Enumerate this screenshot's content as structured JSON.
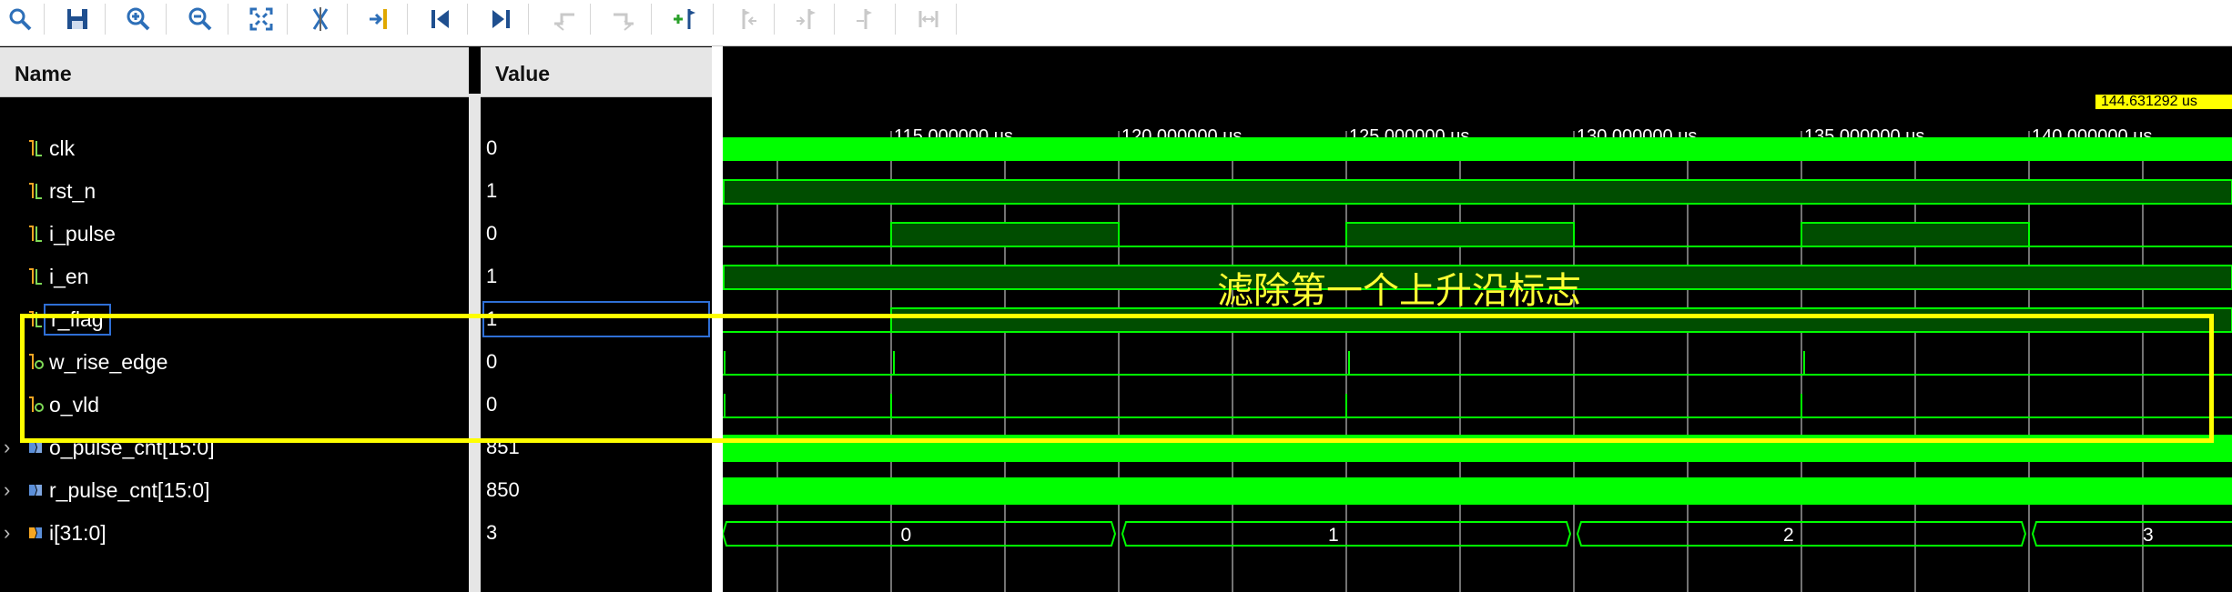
{
  "toolbar": {
    "buttons": [
      {
        "name": "search-icon",
        "enabled": true
      },
      {
        "name": "save-icon",
        "enabled": true
      },
      {
        "name": "zoom-in-icon",
        "enabled": true
      },
      {
        "name": "zoom-out-icon",
        "enabled": true
      },
      {
        "name": "zoom-fit-icon",
        "enabled": true
      },
      {
        "name": "swap-cursor-icon",
        "enabled": true
      },
      {
        "name": "go-to-cursor-icon",
        "enabled": true
      },
      {
        "name": "go-to-time-zero-icon",
        "enabled": true
      },
      {
        "name": "go-to-last-time-icon",
        "enabled": true
      },
      {
        "name": "previous-transition-icon",
        "enabled": false
      },
      {
        "name": "next-transition-icon",
        "enabled": false
      },
      {
        "name": "add-marker-icon",
        "enabled": true
      },
      {
        "name": "previous-marker-icon",
        "enabled": false
      },
      {
        "name": "next-marker-icon",
        "enabled": false
      },
      {
        "name": "swap-markers-icon",
        "enabled": false
      },
      {
        "name": "zoom-to-markers-icon",
        "enabled": false
      }
    ]
  },
  "columns": {
    "name": "Name",
    "value": "Value"
  },
  "cursor_time": "144.631292 us",
  "timeline": {
    "labels": [
      "115.000000 us",
      "120.000000 us",
      "125.000000 us",
      "130.000000 us",
      "135.000000 us",
      "140.000000 us"
    ]
  },
  "signals": [
    {
      "name": "clk",
      "value": "0",
      "type": "bit",
      "expandable": false
    },
    {
      "name": "rst_n",
      "value": "1",
      "type": "bit",
      "expandable": false
    },
    {
      "name": "i_pulse",
      "value": "0",
      "type": "bit",
      "expandable": false
    },
    {
      "name": "i_en",
      "value": "1",
      "type": "bit",
      "expandable": false
    },
    {
      "name": "r_flag",
      "value": "1",
      "type": "bit",
      "expandable": false,
      "selected": true
    },
    {
      "name": "w_rise_edge",
      "value": "0",
      "type": "bit-out",
      "expandable": false
    },
    {
      "name": "o_vld",
      "value": "0",
      "type": "bit-out",
      "expandable": false
    },
    {
      "name": "o_pulse_cnt[15:0]",
      "value": "851",
      "type": "bus",
      "expandable": true
    },
    {
      "name": "r_pulse_cnt[15:0]",
      "value": "850",
      "type": "bus",
      "expandable": true
    },
    {
      "name": "i[31:0]",
      "value": "3",
      "type": "bus-int",
      "expandable": true
    }
  ],
  "bus_values": {
    "i": [
      "0",
      "1",
      "2",
      "3"
    ]
  },
  "annotation": "滤除第一个上升沿标志",
  "colors": {
    "wave": "#00ff00",
    "wave_fill": "#004d00",
    "highlight": "#ffff00",
    "grid": "#bfbfbf"
  }
}
